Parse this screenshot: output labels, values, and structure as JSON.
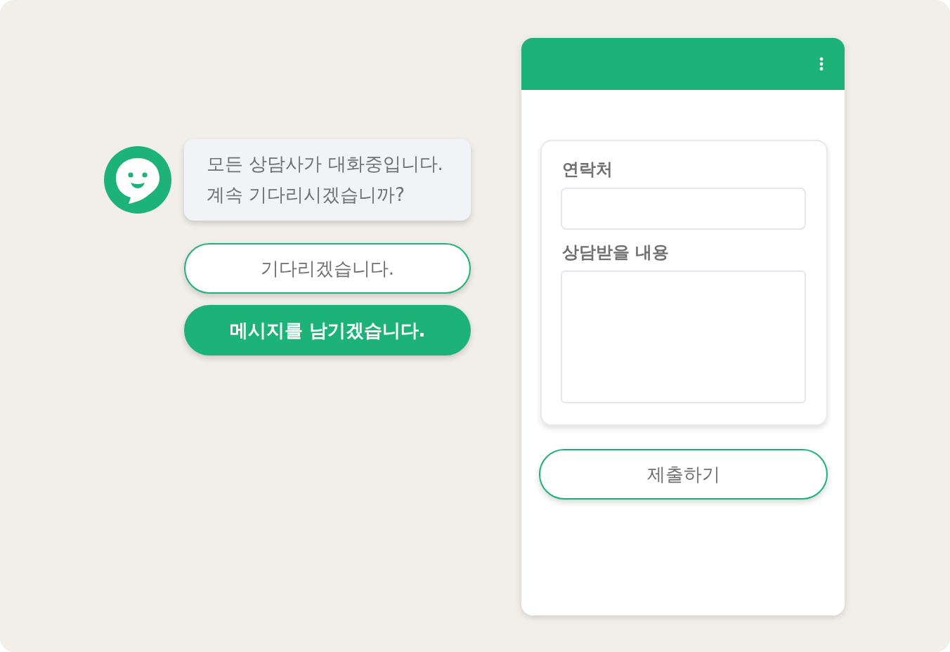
{
  "chat": {
    "message_lines": [
      "모든 상담사가 대화중입니다.",
      "계속 기다리시겠습니까?"
    ],
    "options": [
      {
        "label": "기다리겠습니다.",
        "kind": "outline"
      },
      {
        "label": "메시지를 남기겠습니다.",
        "kind": "filled"
      }
    ]
  },
  "form_panel": {
    "fields": [
      {
        "label": "연락처",
        "kind": "input"
      },
      {
        "label": "상담받을 내용",
        "kind": "textarea"
      }
    ],
    "submit_button": "제출하기"
  }
}
